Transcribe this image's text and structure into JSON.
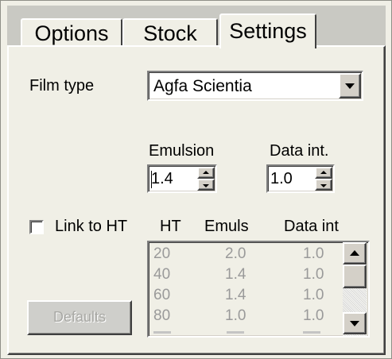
{
  "tabs": [
    {
      "label": "Options",
      "active": false
    },
    {
      "label": "Stock",
      "active": false
    },
    {
      "label": "Settings",
      "active": true
    }
  ],
  "film_type": {
    "label": "Film type",
    "selected": "Agfa Scientia"
  },
  "emulsion": {
    "label": "Emulsion",
    "value": "1.4"
  },
  "data_int": {
    "label": "Data int.",
    "value": "1.0"
  },
  "link_to_ht": {
    "label": "Link to HT",
    "checked": false
  },
  "table": {
    "headers": [
      "HT",
      "Emuls",
      "Data int"
    ],
    "rows": [
      {
        "ht": "20",
        "emuls": "2.0",
        "data_int": "1.0"
      },
      {
        "ht": "40",
        "emuls": "1.4",
        "data_int": "1.0"
      },
      {
        "ht": "60",
        "emuls": "1.4",
        "data_int": "1.0"
      },
      {
        "ht": "80",
        "emuls": "1.0",
        "data_int": "1.0"
      }
    ]
  },
  "defaults_button": "Defaults",
  "icons": {
    "dropdown": "chevron-down-icon",
    "spin_up": "spin-up-icon",
    "spin_down": "spin-down-icon",
    "scroll_up": "scroll-up-icon",
    "scroll_down": "scroll-down-icon"
  }
}
